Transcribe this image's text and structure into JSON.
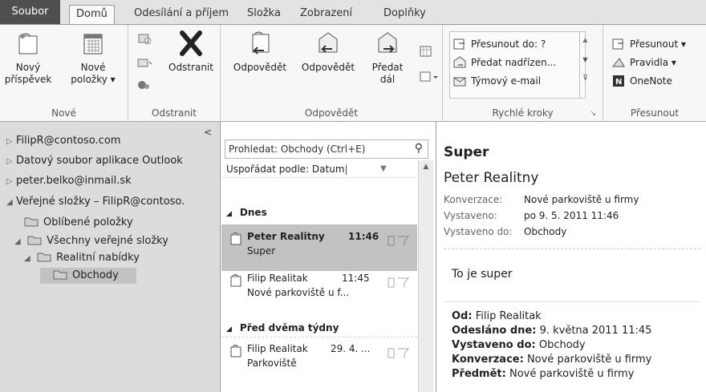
{
  "tabs": {
    "file": "Soubor",
    "home": "Domů",
    "send_receive": "Odesílání a příjem",
    "folder": "Složka",
    "view": "Zobrazení",
    "addins": "Doplňky"
  },
  "ribbon": {
    "new": {
      "new_mail_1": "Nový",
      "new_mail_2": "příspěvek",
      "new_items_1": "Nové",
      "new_items_2": "položky ▾",
      "label": "Nové"
    },
    "delete": {
      "delete_label": "Odstranit",
      "label": "Odstranit"
    },
    "respond": {
      "reply": "Odpovědět",
      "reply_all": "Odpovědět",
      "forward_1": "Předat",
      "forward_2": "dál",
      "label": "Odpovědět"
    },
    "quick_steps": {
      "move_to": "Přesunout do: ?",
      "to_manager": "Předat nadřízen...",
      "team_email": "Týmový e-mail",
      "label": "Rychlé kroky"
    },
    "move": {
      "move": "Přesunout ▾",
      "rules": "Pravidla ▾",
      "onenote": "OneNote",
      "label": "Přesunout"
    }
  },
  "nav": {
    "items": [
      "FilipR@contoso.com",
      "Datový soubor aplikace Outlook",
      "peter.belko@inmail.sk",
      "Veřejné složky – FilipR@contoso.",
      "Oblíbené položky",
      "Všechny veřejné složky",
      "Realitní nabídky",
      "Obchody"
    ]
  },
  "list": {
    "search_placeholder": "Prohledat: Obchody (Ctrl+E)",
    "arrange": "Uspořádat podle: Datum",
    "group_today": "Dnes",
    "group_two_weeks": "Před dvěma týdny",
    "messages": [
      {
        "from": "Peter Realitny",
        "time": "11:46",
        "subject": "Super"
      },
      {
        "from": "Filip Realitak",
        "time": "11:45",
        "subject": "Nové parkoviště u f..."
      },
      {
        "from": "Filip Realitak",
        "time": "29. 4. ...",
        "subject": "Parkoviště"
      }
    ]
  },
  "reading": {
    "subject": "Super",
    "sender": "Peter Realitny",
    "conversation_label": "Konverzace:",
    "conversation_value": "Nové parkoviště u firmy",
    "posted_label": "Vystaveno:",
    "posted_value": "po 9. 5. 2011 11:46",
    "posted_to_label": "Vystaveno do:",
    "posted_to_value": "Obchody",
    "body": "To je super",
    "quote": {
      "from_k": "Od:",
      "from_v": "Filip Realitak",
      "sent_k": "Odesláno dne:",
      "sent_v": "9. května 2011 11:45",
      "posted_to_k": "Vystaveno do:",
      "posted_to_v": "Obchody",
      "conv_k": "Konverzace:",
      "conv_v": "Nové parkoviště u firmy",
      "subj_k": "Předmět:",
      "subj_v": "Nové parkoviště u firmy"
    }
  }
}
